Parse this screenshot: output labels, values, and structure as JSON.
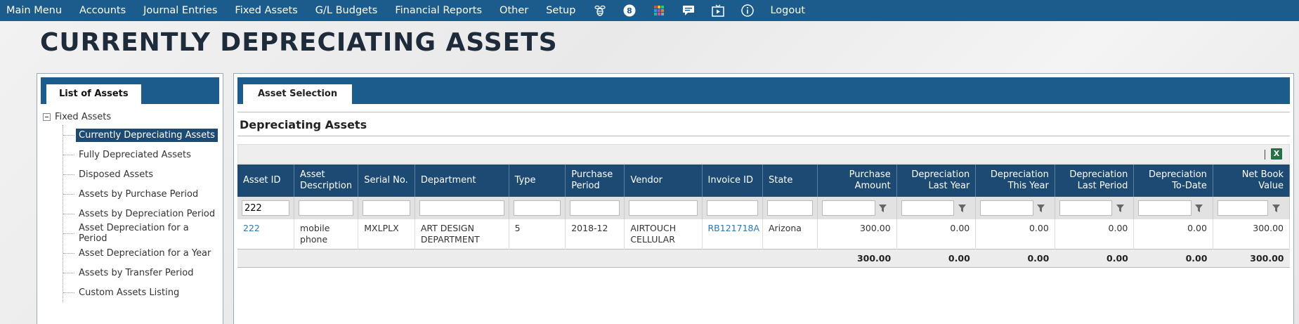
{
  "nav": {
    "items": [
      "Main Menu",
      "Accounts",
      "Journal Entries",
      "Fixed Assets",
      "G/L Budgets",
      "Financial Reports",
      "Other",
      "Setup"
    ],
    "icons": [
      "bee-icon",
      "badge-8-icon",
      "apps-grid-icon",
      "chat-icon",
      "video-icon",
      "info-icon"
    ],
    "badge_count": "8",
    "logout": "Logout"
  },
  "page": {
    "title": "CURRENTLY DEPRECIATING ASSETS"
  },
  "left_panel": {
    "tab": "List of Assets",
    "root": "Fixed Assets",
    "items": [
      {
        "label": "Currently Depreciating Assets",
        "selected": true
      },
      {
        "label": "Fully Depreciated Assets"
      },
      {
        "label": "Disposed Assets"
      },
      {
        "label": "Assets by Purchase Period"
      },
      {
        "label": "Assets by Depreciation Period"
      },
      {
        "label": "Asset Depreciation for a Period"
      },
      {
        "label": "Asset Depreciation for a Year"
      },
      {
        "label": "Assets by Transfer Period"
      },
      {
        "label": "Custom Assets Listing"
      }
    ]
  },
  "right_panel": {
    "tab": "Asset Selection",
    "section_title": "Depreciating Assets",
    "columns": [
      {
        "key": "asset_id",
        "label": "Asset ID"
      },
      {
        "key": "desc",
        "label": "Asset Description"
      },
      {
        "key": "serial",
        "label": "Serial No."
      },
      {
        "key": "dept",
        "label": "Department"
      },
      {
        "key": "type",
        "label": "Type"
      },
      {
        "key": "period",
        "label": "Purchase Period"
      },
      {
        "key": "vendor",
        "label": "Vendor"
      },
      {
        "key": "invoice",
        "label": "Invoice ID"
      },
      {
        "key": "state",
        "label": "State"
      },
      {
        "key": "amount",
        "label": "Purchase Amount",
        "num": true
      },
      {
        "key": "dep_ly",
        "label": "Depreciation Last Year",
        "num": true
      },
      {
        "key": "dep_ty",
        "label": "Depreciation This Year",
        "num": true
      },
      {
        "key": "dep_lp",
        "label": "Depreciation Last Period",
        "num": true
      },
      {
        "key": "dep_td",
        "label": "Depreciation To-Date",
        "num": true
      },
      {
        "key": "nbv",
        "label": "Net Book Value",
        "num": true
      }
    ],
    "filter_asset_id": "222",
    "rows": [
      {
        "asset_id": "222",
        "desc": "mobile phone",
        "serial": "MXLPLX",
        "dept": "ART DESIGN DEPARTMENT",
        "type": "5",
        "period": "2018-12",
        "vendor": "AIRTOUCH CELLULAR",
        "invoice": "RB121718A",
        "state": "Arizona",
        "amount": "300.00",
        "dep_ly": "0.00",
        "dep_ty": "0.00",
        "dep_lp": "0.00",
        "dep_td": "0.00",
        "nbv": "300.00"
      }
    ],
    "totals": {
      "amount": "300.00",
      "dep_ly": "0.00",
      "dep_ty": "0.00",
      "dep_lp": "0.00",
      "dep_td": "0.00",
      "nbv": "300.00"
    }
  }
}
